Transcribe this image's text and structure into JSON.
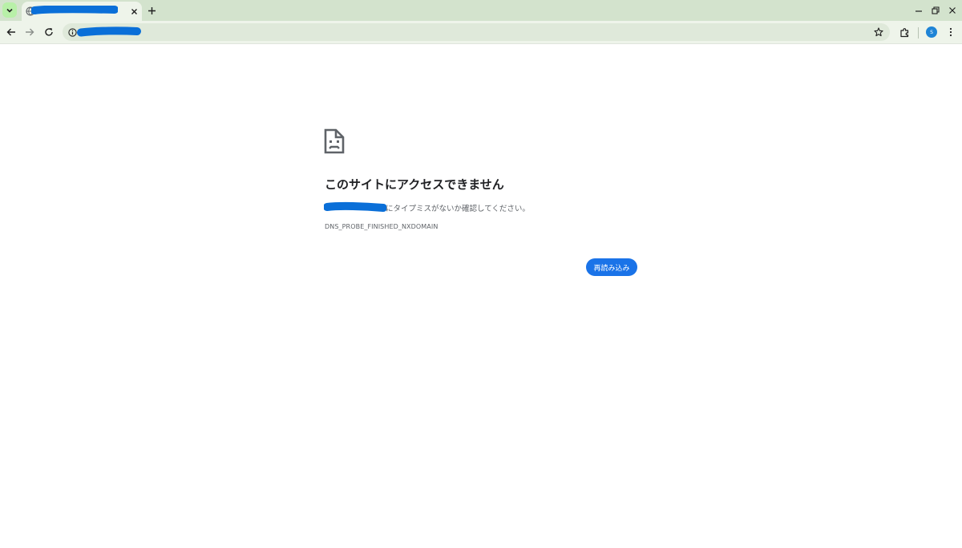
{
  "tabs": {
    "active_tab_title": "",
    "close_label": "×",
    "new_tab_label": "+"
  },
  "omnibox": {
    "url": "",
    "placeholder": ""
  },
  "profile": {
    "avatar_initial": "S"
  },
  "error": {
    "title": "このサイトにアクセスできません",
    "description_suffix": "にタイプミスがないか確認してください。",
    "code": "DNS_PROBE_FINISHED_NXDOMAIN",
    "reload_label": "再読み込み"
  },
  "colors": {
    "tabstrip": "#d3e3cd",
    "toolbar": "#eef4ea",
    "accent": "#1a73e8",
    "redaction": "#0a6fd8"
  },
  "icons": {
    "tab_search": "chevron-down-icon",
    "favicon": "globe-icon",
    "back": "back-arrow-icon",
    "forward": "forward-arrow-icon",
    "reload": "reload-icon",
    "site_info": "info-icon",
    "bookmark": "star-icon",
    "extensions": "puzzle-icon",
    "menu": "kebab-menu-icon",
    "minimize": "minimize-icon",
    "restore": "restore-icon",
    "close": "close-icon",
    "error": "sad-document-icon"
  }
}
